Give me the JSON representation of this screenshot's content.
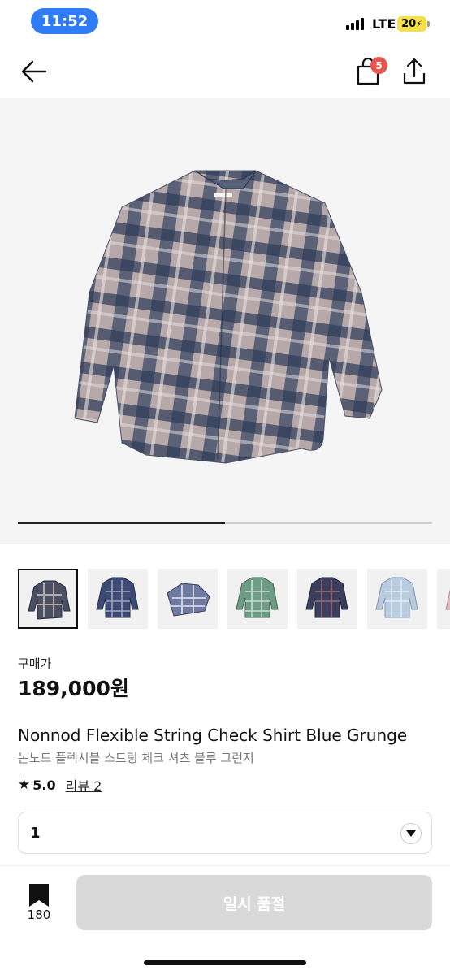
{
  "status_bar": {
    "time": "11:52",
    "network": "LTE",
    "battery": "20"
  },
  "header": {
    "back_icon": "arrow-left-icon",
    "bag_icon": "shopping-bag-icon",
    "bag_count": "5",
    "share_icon": "share-icon"
  },
  "gallery": {
    "progress_fraction": 0.5,
    "thumbnail_count": 7
  },
  "product": {
    "price_label": "구매가",
    "price": "189,000원",
    "title_en": "Nonnod Flexible String Check Shirt Blue Grunge",
    "title_ko": "논노드 플렉시블 스트링 체크 셔츠 블루 그런지",
    "rating": "5.0",
    "review_link": "리뷰 2"
  },
  "quantity": {
    "value": "1"
  },
  "bottom_bar": {
    "bookmark_count": "180",
    "soldout_label": "일시 품절"
  },
  "colors": {
    "accent_blue": "#2f7cf6",
    "badge_red": "#e8554e",
    "disabled_button": "#d9d9d9",
    "battery_yellow": "#f4e04a"
  }
}
